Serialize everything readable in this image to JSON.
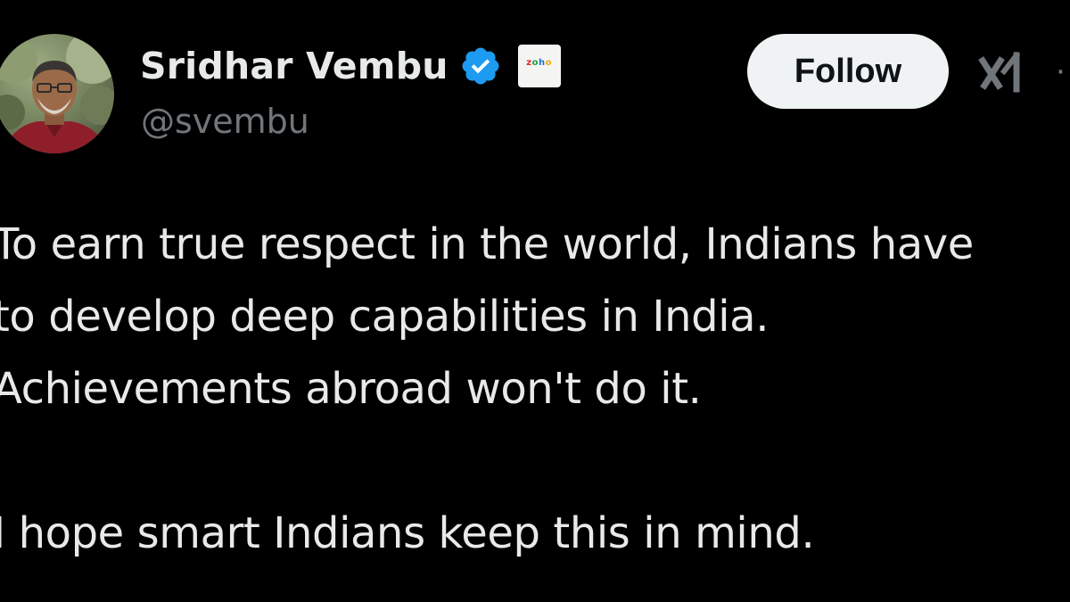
{
  "author": {
    "display_name": "Sridhar Vembu",
    "handle": "@svembu",
    "verified": true,
    "affiliate_badge": "zoho-logo"
  },
  "header": {
    "follow_label": "Follow",
    "icons": [
      "verified-icon",
      "grok-icon",
      "more-icon"
    ]
  },
  "tweet": {
    "paragraph1": [
      "To earn true respect in the world, Indians have",
      "to develop deep capabilities in India.",
      "Achievements abroad won't do it."
    ],
    "paragraph2": [
      "I hope smart Indians keep this in mind."
    ]
  },
  "colors": {
    "background": "#000000",
    "text_primary": "#e7e9ea",
    "text_secondary": "#71767b",
    "verified_blue": "#1d9bf0",
    "follow_button_bg": "#eff3f4"
  }
}
